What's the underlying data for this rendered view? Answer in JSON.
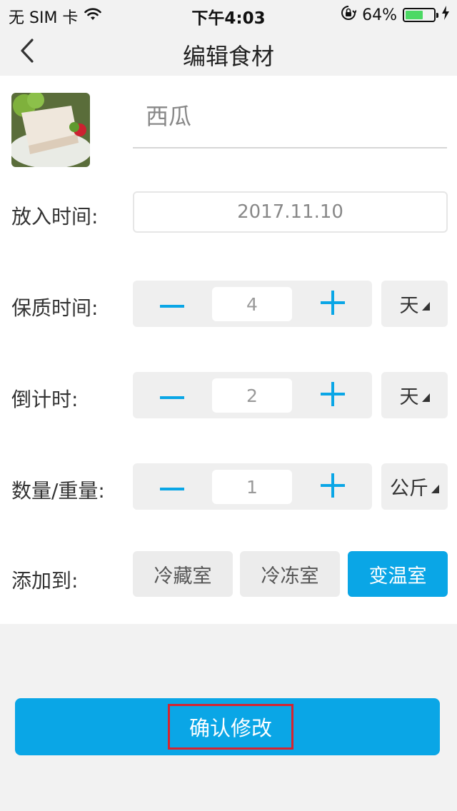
{
  "status_bar": {
    "carrier": "无 SIM 卡",
    "time": "下午4:03",
    "battery_percent": "64%",
    "battery_level": 0.64,
    "icons": [
      "wifi-icon",
      "orientation-lock-icon",
      "battery-icon",
      "charging-icon"
    ]
  },
  "nav": {
    "title": "编辑食材",
    "back_icon": "chevron-left-icon"
  },
  "form": {
    "name_value": "西瓜",
    "put_in_time": {
      "label": "放入时间:",
      "value": "2017.11.10"
    },
    "shelf_life": {
      "label": "保质时间:",
      "value": "4",
      "unit": "天"
    },
    "countdown": {
      "label": "倒计时:",
      "value": "2",
      "unit": "天"
    },
    "quantity": {
      "label": "数量/重量:",
      "value": "1",
      "unit": "公斤"
    },
    "add_to": {
      "label": "添加到:",
      "options": [
        "冷藏室",
        "冷冻室",
        "变温室"
      ],
      "selected": "变温室"
    }
  },
  "confirm_label": "确认修改",
  "colors": {
    "accent": "#0aa6e6",
    "highlight_border": "#d6242f",
    "page_bg": "#f2f2f2",
    "control_bg": "#efefef"
  }
}
